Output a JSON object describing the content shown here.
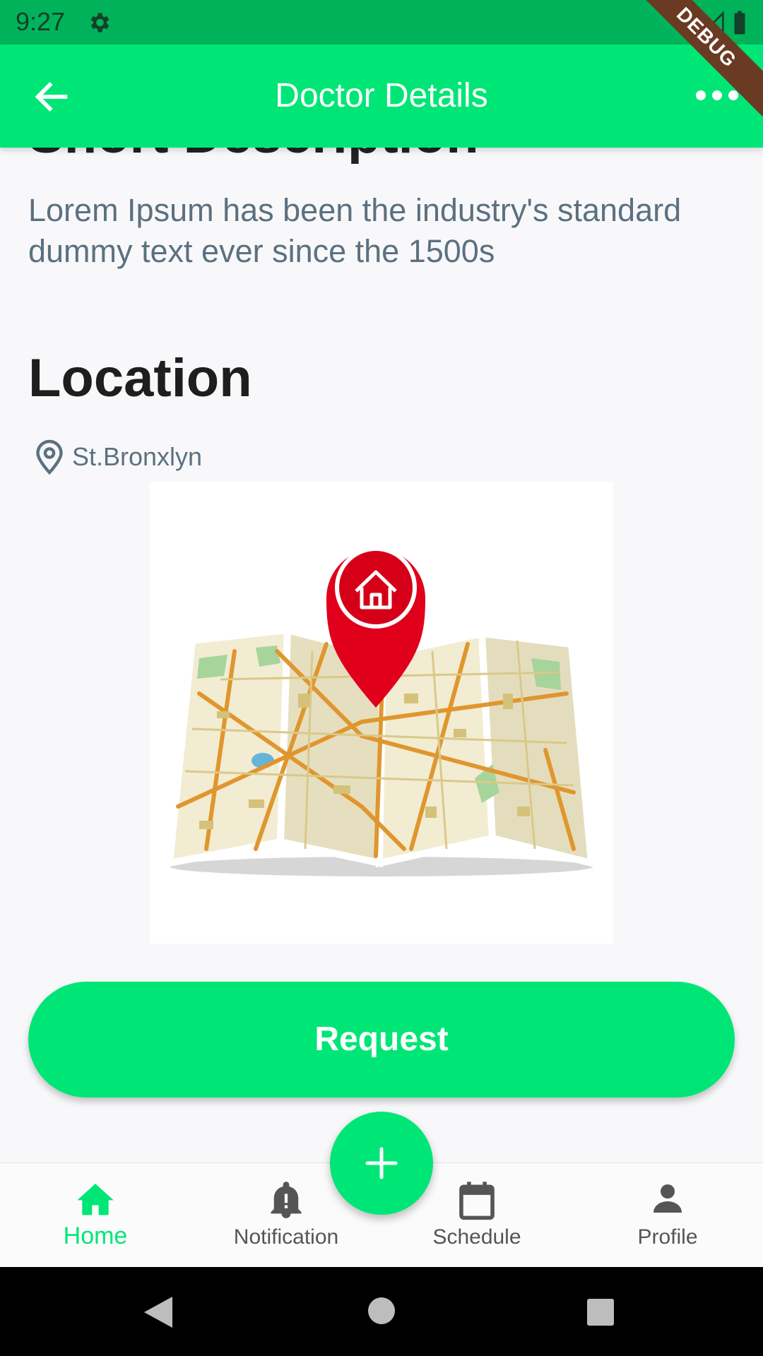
{
  "status_bar": {
    "time": "9:27"
  },
  "debug_banner": "DEBUG",
  "app_bar": {
    "title": "Doctor Details"
  },
  "content": {
    "section_title_partial": "Short Description",
    "description": "Lorem Ipsum has been the industry's standard dummy text ever since the 1500s",
    "location_title": "Location",
    "location_name": "St.Bronxlyn",
    "request_label": "Request"
  },
  "bottom_nav": {
    "items": [
      {
        "label": "Home",
        "icon": "home-icon",
        "active": true
      },
      {
        "label": "Notification",
        "icon": "bell-icon",
        "active": false
      },
      {
        "label": "Schedule",
        "icon": "calendar-icon",
        "active": false
      },
      {
        "label": "Profile",
        "icon": "person-icon",
        "active": false
      }
    ],
    "fab_icon": "plus-icon"
  },
  "colors": {
    "primary": "#00e676",
    "status_bar": "#00b35a",
    "text_secondary": "#5b7180",
    "pin_red": "#e0001b"
  }
}
